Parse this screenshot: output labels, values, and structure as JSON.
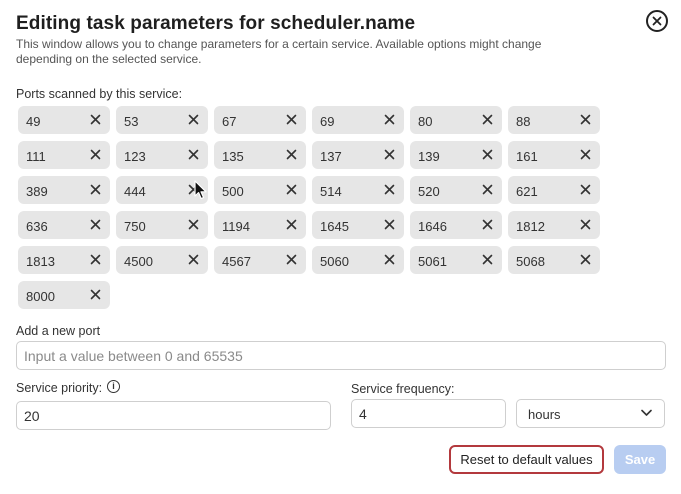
{
  "dialog": {
    "title": "Editing task parameters for scheduler.name",
    "description": "This window allows you to change parameters for a certain service. Available options might change depending on the selected service.",
    "close_icon": "close-circle-icon"
  },
  "ports": {
    "label": "Ports scanned by this service:",
    "remove_icon": "x-icon",
    "items": [
      "49",
      "53",
      "67",
      "69",
      "80",
      "88",
      "111",
      "123",
      "135",
      "137",
      "139",
      "161",
      "389",
      "444",
      "500",
      "514",
      "520",
      "621",
      "636",
      "750",
      "1194",
      "1645",
      "1646",
      "1812",
      "1813",
      "4500",
      "4567",
      "5060",
      "5061",
      "5068",
      "8000"
    ]
  },
  "new_port": {
    "label": "Add a new port",
    "value": "",
    "placeholder": "Input a value between 0 and 65535"
  },
  "priority": {
    "label": "Service priority:",
    "value": "20",
    "info_icon": "info-icon"
  },
  "frequency": {
    "label": "Service frequency:",
    "value": "4",
    "unit": "hours",
    "unit_options": [
      "hours"
    ]
  },
  "actions": {
    "reset_label": "Reset to default values",
    "save_label": "Save"
  },
  "colors": {
    "chip_bg": "#e6e6e6",
    "reset_border": "#b3393d",
    "save_bg_disabled": "#b8cdf1"
  }
}
